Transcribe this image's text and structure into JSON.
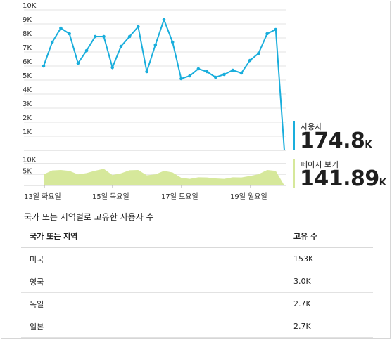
{
  "chart_data": [
    {
      "type": "line",
      "title": "",
      "yticks": [
        "1K",
        "2K",
        "3K",
        "4K",
        "5K",
        "6K",
        "7K",
        "8K",
        "9K",
        "10K"
      ],
      "ylim": [
        0,
        10000
      ],
      "x_labels": [
        "13일 화요일",
        "15일 목요일",
        "17일 토요일",
        "19일 월요일"
      ],
      "series": [
        {
          "name": "사용자",
          "color": "#1aaedc",
          "values": [
            6000,
            7700,
            8700,
            8300,
            6200,
            7100,
            8100,
            8100,
            5900,
            7400,
            8100,
            8800,
            5600,
            7500,
            9300,
            7700,
            5100,
            5300,
            5800,
            5600,
            5200,
            5400,
            5700,
            5500,
            6400,
            6900,
            8300,
            8600,
            0
          ]
        }
      ]
    },
    {
      "type": "area",
      "yticks": [
        "5K",
        "10K"
      ],
      "ylim": [
        0,
        14000
      ],
      "series": [
        {
          "name": "페이지 보기",
          "color": "#d6e89b",
          "values": [
            5000,
            6800,
            7000,
            6600,
            5000,
            5600,
            6700,
            7500,
            4700,
            5500,
            6900,
            7000,
            4600,
            5000,
            6600,
            5900,
            3500,
            3000,
            3700,
            3600,
            3200,
            3000,
            3700,
            3600,
            4300,
            5100,
            7000,
            6600,
            0
          ]
        }
      ]
    }
  ],
  "kpis": [
    {
      "label": "사용자",
      "value": "174.8",
      "unit": "K",
      "color": "#1aaedc"
    },
    {
      "label": "페이지 보기",
      "value": "141.89",
      "unit": "K",
      "color": "#d6e89b"
    }
  ],
  "table": {
    "title": "국가 또는 지역별로 고유한 사용자 수",
    "headers": [
      "국가 또는 지역",
      "고유 수"
    ],
    "rows": [
      {
        "region": "미국",
        "count": "153K"
      },
      {
        "region": "영국",
        "count": "3.0K"
      },
      {
        "region": "독일",
        "count": "2.7K"
      },
      {
        "region": "일본",
        "count": "2.7K"
      }
    ]
  }
}
